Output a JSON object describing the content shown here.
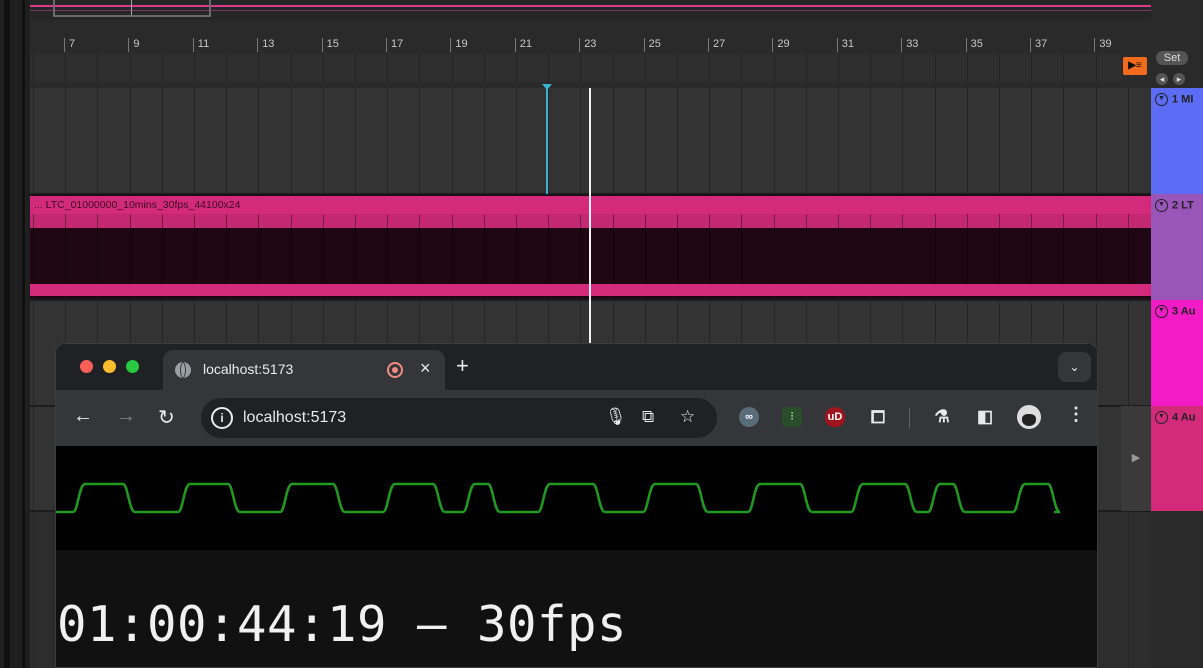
{
  "ruler": {
    "bars": [
      "7",
      "9",
      "11",
      "13",
      "15",
      "17",
      "19",
      "21",
      "23",
      "25",
      "27",
      "29",
      "31",
      "33",
      "35",
      "37",
      "39"
    ]
  },
  "arrangement": {
    "set_label": "Set",
    "clip_name": "... LTC_01000000_10mins_30fps_44100x24"
  },
  "tracks": [
    {
      "label": "1 MI",
      "color": "#5c6cf5"
    },
    {
      "label": "2 LT",
      "color": "#9a55b8"
    },
    {
      "label": "3 Au",
      "color": "#f21bc5"
    },
    {
      "label": "4 Au",
      "color": "#d42a7c"
    }
  ],
  "browser": {
    "tab_title": "localhost:5173",
    "url": "localhost:5173",
    "new_tab": "+",
    "close": "×"
  },
  "page": {
    "timecode": "01:00:44:19 – 30fps",
    "waveform_color": "#1f9a1f"
  }
}
